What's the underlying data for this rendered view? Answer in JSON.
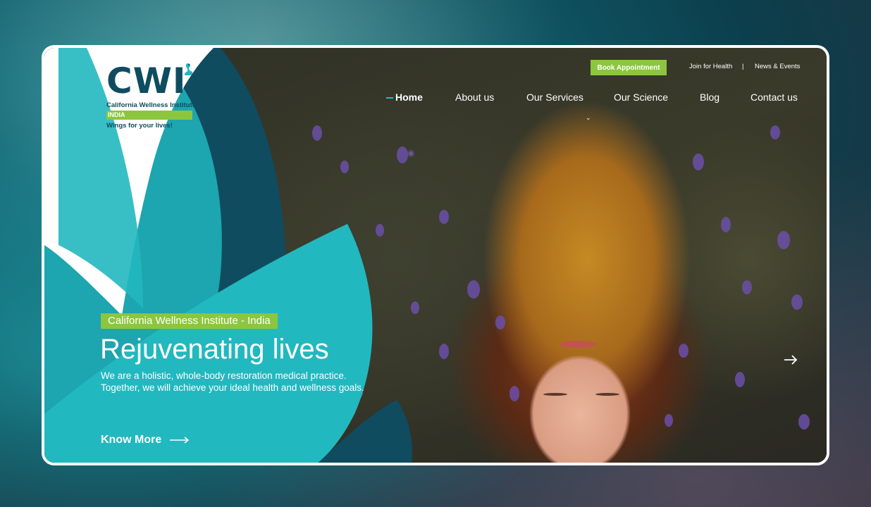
{
  "header": {
    "book_appointment": "Book Appointment",
    "join_for_health": "Join for Health",
    "separator": "|",
    "news_events": "News & Events"
  },
  "nav": {
    "items": [
      {
        "label": "Home",
        "active": true
      },
      {
        "label": "About us"
      },
      {
        "label": "Our Services"
      },
      {
        "label": "Our Science"
      },
      {
        "label": "Blog"
      },
      {
        "label": "Contact us"
      }
    ]
  },
  "logo": {
    "mark": "CWI",
    "name": "California Wellness Institute",
    "region": "INDIA",
    "tagline": "Wings for your lives!"
  },
  "hero": {
    "tag": "California Wellness Institute - India",
    "title": "Rejuvenating lives",
    "description": "We are a holistic, whole-body restoration medical practice. Together, we will achieve your ideal health and wellness goals.",
    "cta": "Know More"
  },
  "icons": {
    "next": "arrow-right-icon",
    "cta_arrow": "long-arrow-right-icon",
    "dropdown": "chevron-down-icon",
    "logo_bird": "swan-icon"
  },
  "colors": {
    "teal": "#22b8bf",
    "dark_teal": "#0f4c5f",
    "green": "#8cc63f",
    "white": "#ffffff"
  }
}
